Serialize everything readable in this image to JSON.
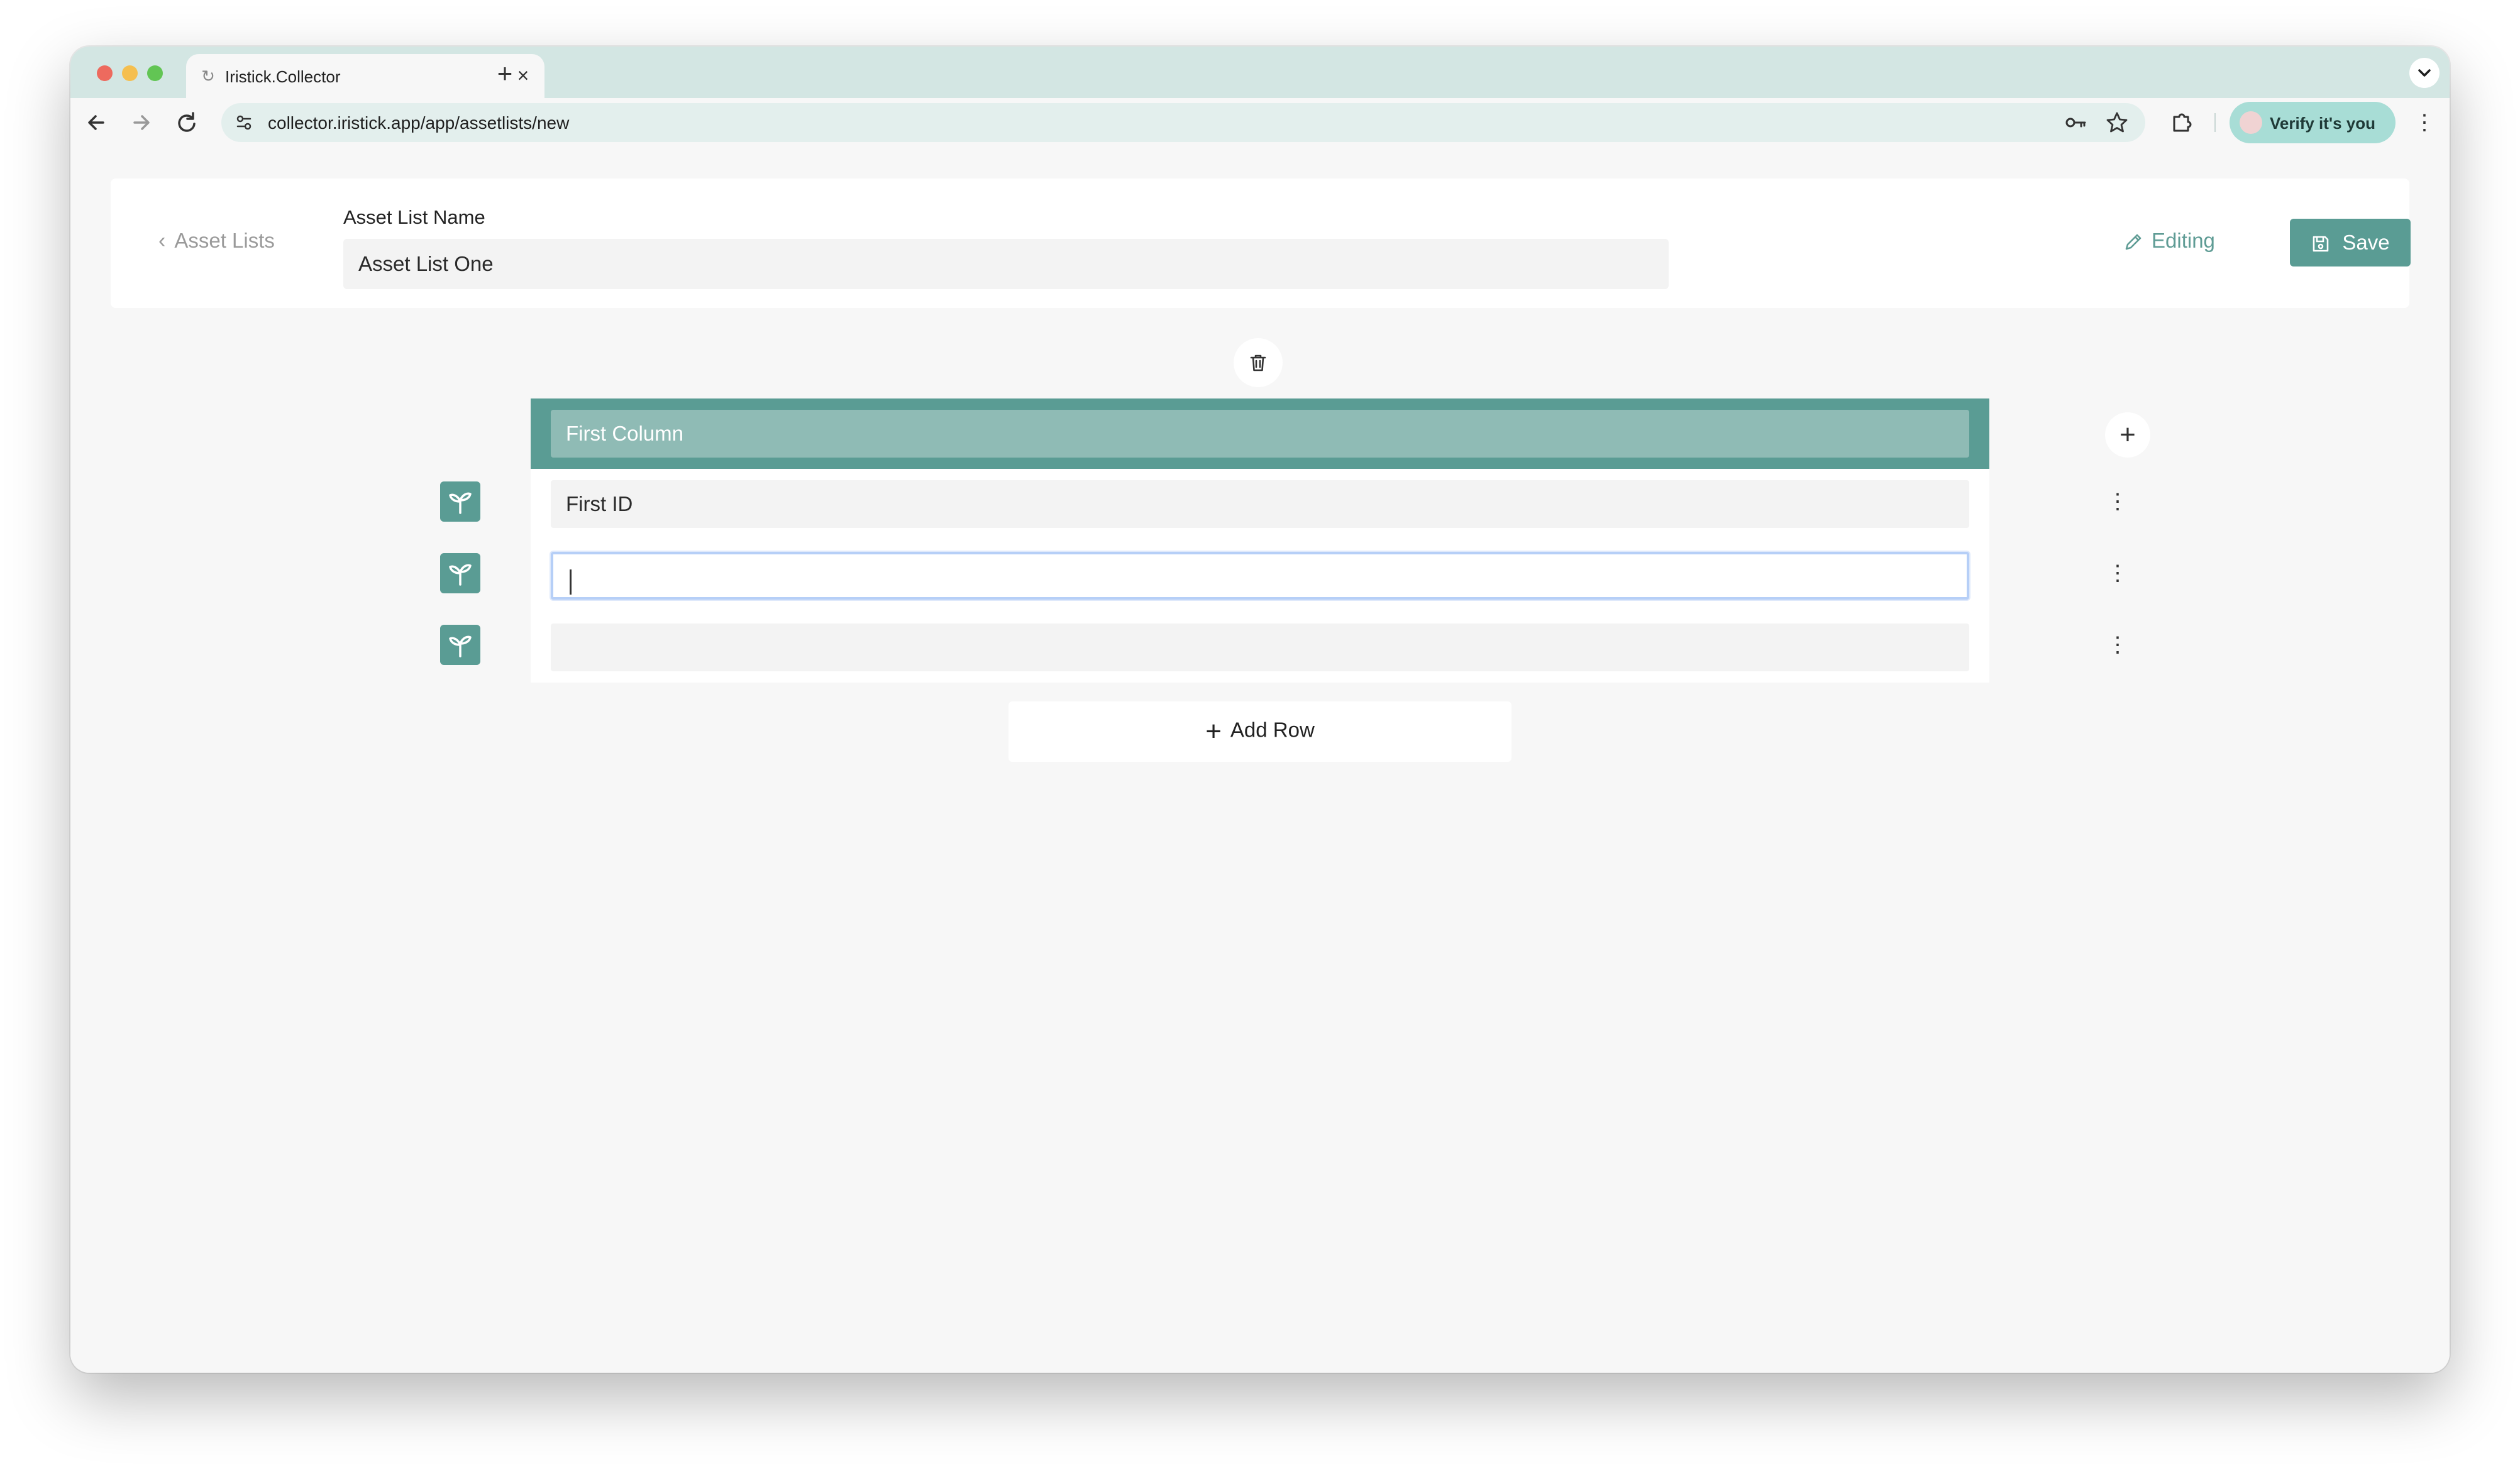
{
  "browser": {
    "tab": {
      "title": "Iristick.Collector"
    },
    "url": "collector.iristick.app/app/assetlists/new",
    "profile_label": "Verify it's you"
  },
  "header": {
    "back_label": "Asset Lists",
    "name_label": "Asset List Name",
    "name_value": "Asset List One",
    "editing_label": "Editing",
    "save_label": "Save"
  },
  "table": {
    "column_header": "First Column",
    "rows": [
      {
        "value": "First ID"
      },
      {
        "value": ""
      },
      {
        "value": ""
      }
    ],
    "add_row_label": "Add Row"
  },
  "icons": {
    "row_icon": "sprout-icon",
    "delete_column": "trash-icon",
    "add_column": "plus-icon",
    "row_menu": "more-vertical-icon"
  },
  "colors": {
    "accent": "#5a9c94",
    "accent_light": "#8fbbb5",
    "tabbar": "#d3e6e3",
    "omnibox": "#e3efed",
    "profile_chip": "#a8ddd6",
    "focus_ring": "#b6cff7"
  }
}
